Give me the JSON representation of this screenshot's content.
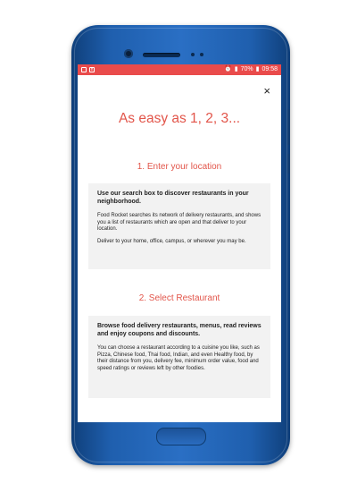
{
  "status_bar": {
    "left_icons": [
      "image-icon",
      "facebook-icon"
    ],
    "battery": "70%",
    "time": "09:58",
    "accent": "#e94b4b"
  },
  "close_label": "×",
  "heading": "As easy as 1, 2, 3...",
  "steps": [
    {
      "title": "1. Enter your location",
      "bold": "Use our search box to discover restaurants in your neighborhood.",
      "paragraphs": [
        "Food Rocket searches its network of delivery restaurants, and shows you a list of restaurants which are open and that deliver to your location.",
        "Deliver to your home, office, campus, or wherever you may be."
      ]
    },
    {
      "title": "2. Select Restaurant",
      "bold": "Browse food delivery restaurants, menus, read reviews and enjoy coupons and discounts.",
      "paragraphs": [
        "You can choose a restaurant according to a cuisine you like, such as Pizza, Chinese food, Thai food, Indian, and even Healthy food, by their distance from you, delivery fee, minimum order value, food and speed ratings or reviews left by other foodies."
      ]
    }
  ]
}
